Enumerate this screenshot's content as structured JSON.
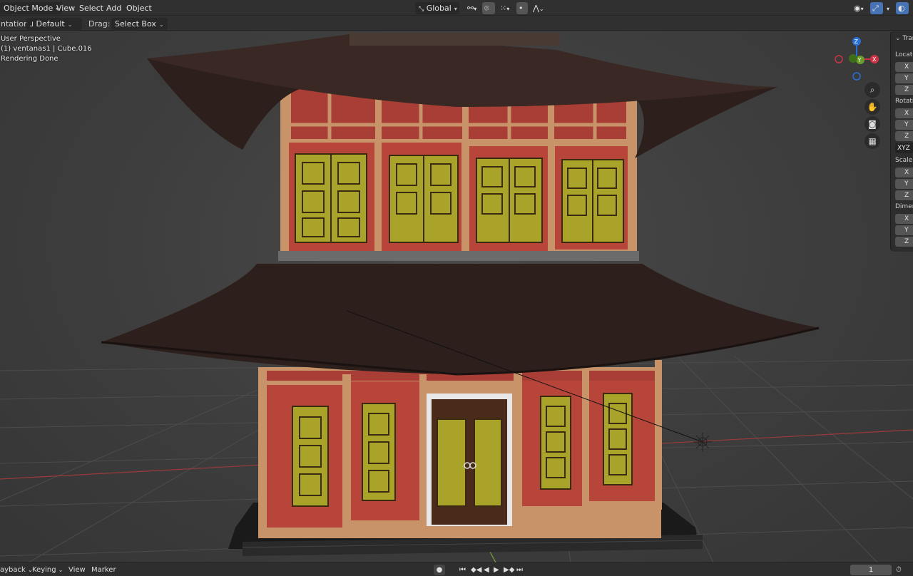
{
  "header": {
    "mode": "Object Mode",
    "menus": [
      "View",
      "Select",
      "Add",
      "Object"
    ],
    "transform_orientation": "Global",
    "colors": {
      "bg": "#303030",
      "accent": "#4772b3"
    }
  },
  "toolbar": {
    "orientation_label": "ntation:",
    "orientation_value": "Default",
    "drag_label": "Drag:",
    "drag_value": "Select Box"
  },
  "viewport": {
    "perspective": "User Perspective",
    "object_info": "(1) ventanas1  | Cube.016",
    "status": "Rendering Done"
  },
  "gizmo": {
    "x": "X",
    "y": "Y",
    "z": "Z"
  },
  "npanel": {
    "tab": "Trar",
    "location": "Locatio",
    "rotation": "Rotatio",
    "scale": "Scale:",
    "dimensions": "Dimen",
    "rotation_mode": "XYZ",
    "axes": [
      "X",
      "Y",
      "Z"
    ]
  },
  "timeline": {
    "playback": "ayback",
    "keying": "Keying",
    "view": "View",
    "marker": "Marker",
    "current_frame": "1"
  },
  "icons": [
    "orientation-icon",
    "pivot-icon",
    "snap-icon",
    "proportional-icon",
    "visibility-icon",
    "gizmo-icon",
    "overlay-icon",
    "zoom-icon",
    "pan-icon",
    "camera-icon",
    "grid-icon",
    "record-icon",
    "jump-start-icon",
    "prev-key-icon",
    "play-reverse-icon",
    "play-icon",
    "next-key-icon",
    "jump-end-icon",
    "timer-icon"
  ]
}
